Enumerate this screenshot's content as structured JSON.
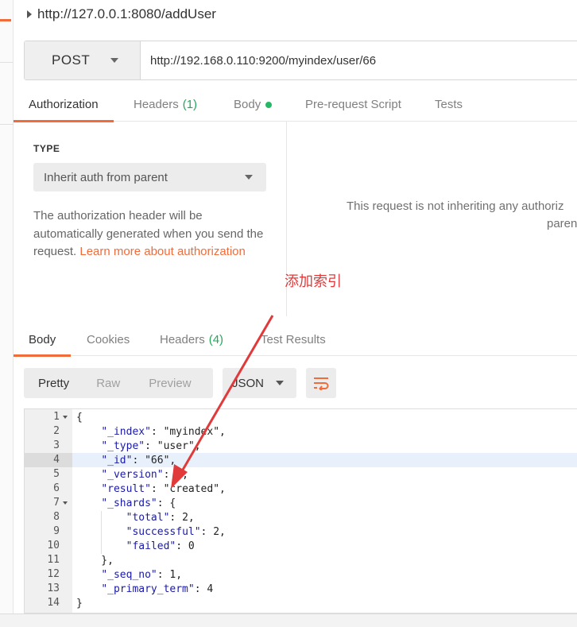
{
  "request": {
    "title": "http://127.0.0.1:8080/addUser",
    "method": "POST",
    "url": "http://192.168.0.110:9200/myindex/user/66"
  },
  "request_tabs": [
    {
      "label": "Authorization",
      "count": "",
      "active": true
    },
    {
      "label": "Headers",
      "count": "(1)",
      "active": false
    },
    {
      "label": "Body",
      "count": "",
      "active": false,
      "dot": true
    },
    {
      "label": "Pre-request Script",
      "count": "",
      "active": false
    },
    {
      "label": "Tests",
      "count": "",
      "active": false
    }
  ],
  "auth": {
    "type_label": "TYPE",
    "type_value": "Inherit auth from parent",
    "description": "The authorization header will be automatically generated when you send the request.",
    "link_text_1": "Learn more about",
    "link_text_2": "authorization",
    "right_message_line1": "This request is not inheriting any authoriz",
    "right_message_line2": "paren"
  },
  "annotation": {
    "text": "添加索引",
    "color": "#e03a3a"
  },
  "response_tabs": [
    {
      "label": "Body",
      "count": "",
      "active": true
    },
    {
      "label": "Cookies",
      "count": "",
      "active": false
    },
    {
      "label": "Headers",
      "count": "(4)",
      "active": false
    },
    {
      "label": "Test Results",
      "count": "",
      "active": false
    }
  ],
  "response_toolbar": {
    "views": [
      "Pretty",
      "Raw",
      "Preview"
    ],
    "selected_view": "Pretty",
    "format": "JSON",
    "wrap_icon": "wrap-lines-icon"
  },
  "code_lines": [
    {
      "n": "1",
      "fold": true,
      "t": "{"
    },
    {
      "n": "2",
      "fold": false,
      "t": "    \"_index\": \"myindex\","
    },
    {
      "n": "3",
      "fold": false,
      "t": "    \"_type\": \"user\","
    },
    {
      "n": "4",
      "fold": false,
      "t": "    \"_id\": \"66\",",
      "highlight": true
    },
    {
      "n": "5",
      "fold": false,
      "t": "    \"_version\": 1,"
    },
    {
      "n": "6",
      "fold": false,
      "t": "    \"result\": \"created\","
    },
    {
      "n": "7",
      "fold": true,
      "t": "    \"_shards\": {"
    },
    {
      "n": "8",
      "fold": false,
      "t": "        \"total\": 2,"
    },
    {
      "n": "9",
      "fold": false,
      "t": "        \"successful\": 2,"
    },
    {
      "n": "10",
      "fold": false,
      "t": "        \"failed\": 0"
    },
    {
      "n": "11",
      "fold": false,
      "t": "    },"
    },
    {
      "n": "12",
      "fold": false,
      "t": "    \"_seq_no\": 1,"
    },
    {
      "n": "13",
      "fold": false,
      "t": "    \"_primary_term\": 4"
    },
    {
      "n": "14",
      "fold": false,
      "t": "}"
    }
  ],
  "colors": {
    "accent": "#f26b3a",
    "count_green": "#26a65b",
    "json_value": "#1a1aa6"
  }
}
